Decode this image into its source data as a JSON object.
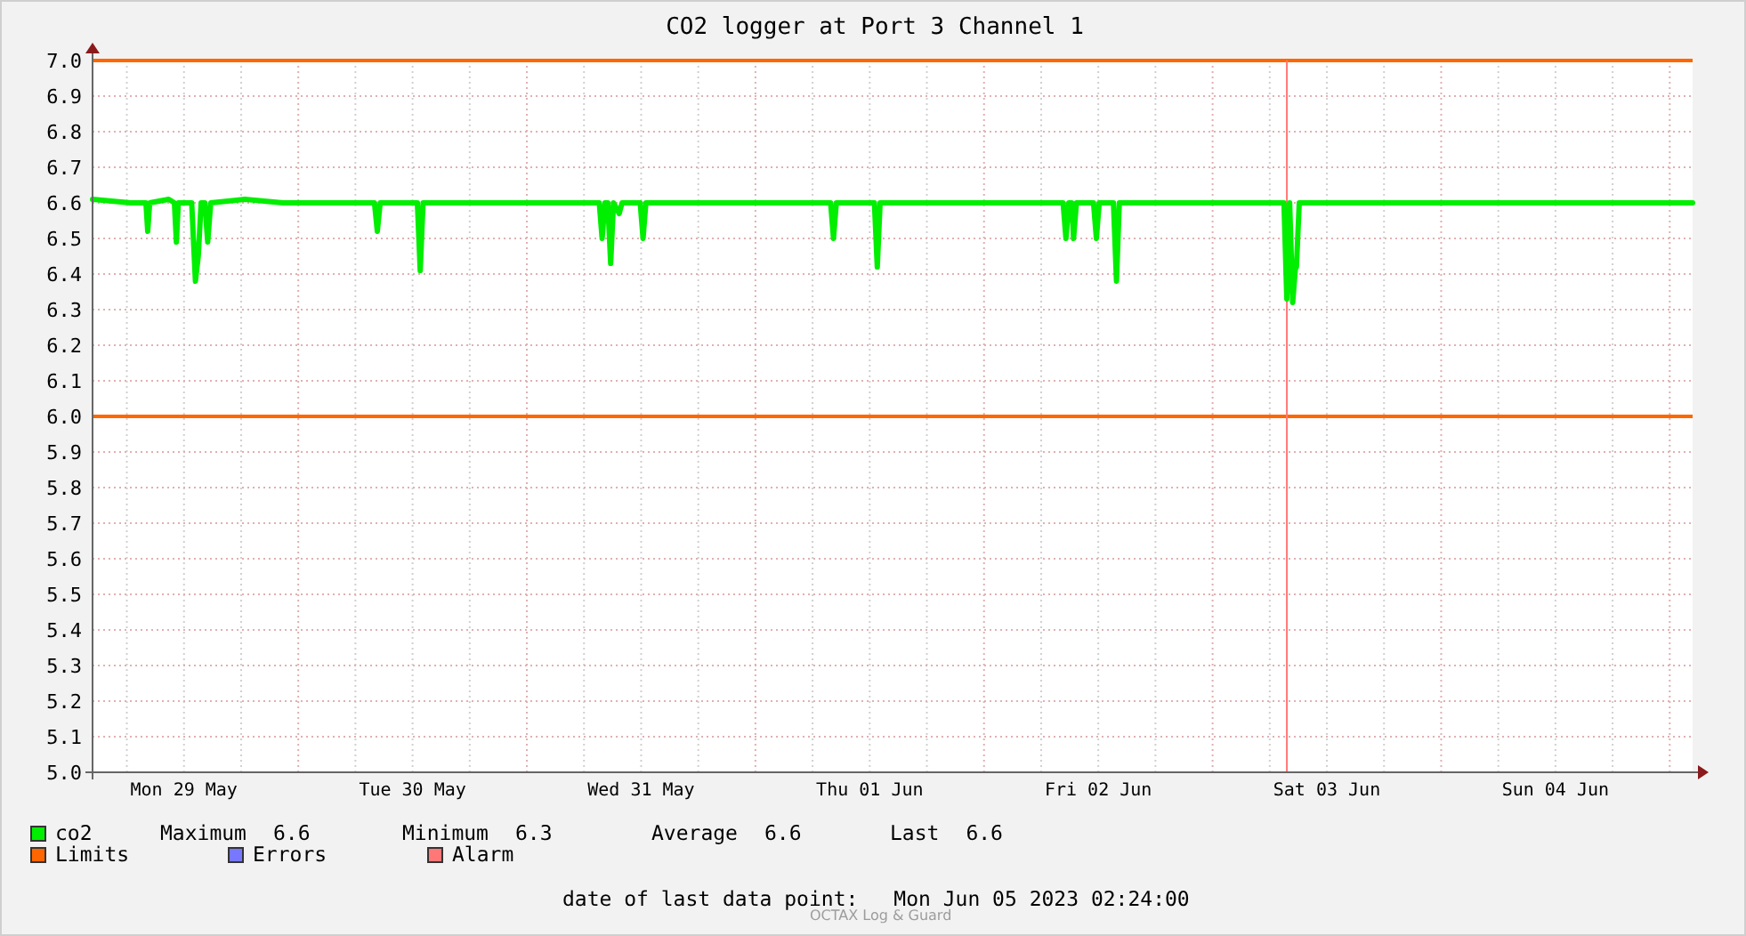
{
  "chart": {
    "chart_data": {
      "type": "line",
      "title": "CO2 logger at Port 3 Channel 1",
      "x": [
        "2023-05-29T02:24",
        "2023-05-29T06:24",
        "2023-05-29T08:00",
        "2023-05-29T08:12",
        "2023-05-29T08:24",
        "2023-05-29T10:24",
        "2023-05-29T11:00",
        "2023-05-29T11:12",
        "2023-05-29T11:24",
        "2023-05-29T12:48",
        "2023-05-29T13:12",
        "2023-05-29T13:30",
        "2023-05-29T13:48",
        "2023-05-29T14:12",
        "2023-05-29T14:30",
        "2023-05-29T14:48",
        "2023-05-29T18:24",
        "2023-05-29T22:24",
        "2023-05-30T02:24",
        "2023-05-30T08:00",
        "2023-05-30T08:18",
        "2023-05-30T08:36",
        "2023-05-30T12:30",
        "2023-05-30T12:48",
        "2023-05-30T13:06",
        "2023-05-30T18:24",
        "2023-05-31T02:24",
        "2023-05-31T07:36",
        "2023-05-31T07:54",
        "2023-05-31T08:12",
        "2023-05-31T08:30",
        "2023-05-31T08:48",
        "2023-05-31T09:06",
        "2023-05-31T09:42",
        "2023-05-31T10:00",
        "2023-05-31T11:54",
        "2023-05-31T12:12",
        "2023-05-31T12:30",
        "2023-05-31T18:24",
        "2023-06-01T02:24",
        "2023-06-01T07:54",
        "2023-06-01T08:12",
        "2023-06-01T08:30",
        "2023-06-01T12:30",
        "2023-06-01T12:48",
        "2023-06-01T13:06",
        "2023-06-01T18:24",
        "2023-06-02T02:24",
        "2023-06-02T08:18",
        "2023-06-02T08:36",
        "2023-06-02T08:54",
        "2023-06-02T09:12",
        "2023-06-02T09:24",
        "2023-06-02T09:42",
        "2023-06-02T11:30",
        "2023-06-02T11:48",
        "2023-06-02T12:06",
        "2023-06-02T13:36",
        "2023-06-02T13:54",
        "2023-06-02T14:12",
        "2023-06-02T18:24",
        "2023-06-03T02:24",
        "2023-06-03T07:30",
        "2023-06-03T07:48",
        "2023-06-03T08:06",
        "2023-06-03T08:24",
        "2023-06-03T08:42",
        "2023-06-03T08:48",
        "2023-06-03T09:06",
        "2023-06-03T14:24",
        "2023-06-03T22:24",
        "2023-06-04T06:24",
        "2023-06-04T14:24",
        "2023-06-04T22:24",
        "2023-06-05T02:24"
      ],
      "series": [
        {
          "name": "co2",
          "color": "#00ee00",
          "values": [
            6.61,
            6.6,
            6.6,
            6.52,
            6.6,
            6.61,
            6.6,
            6.49,
            6.6,
            6.6,
            6.38,
            6.45,
            6.6,
            6.6,
            6.49,
            6.6,
            6.61,
            6.6,
            6.6,
            6.6,
            6.52,
            6.6,
            6.6,
            6.41,
            6.6,
            6.6,
            6.6,
            6.6,
            6.5,
            6.6,
            6.6,
            6.43,
            6.6,
            6.57,
            6.6,
            6.6,
            6.5,
            6.6,
            6.6,
            6.6,
            6.6,
            6.5,
            6.6,
            6.6,
            6.42,
            6.6,
            6.6,
            6.6,
            6.6,
            6.5,
            6.6,
            6.6,
            6.5,
            6.6,
            6.6,
            6.5,
            6.6,
            6.6,
            6.38,
            6.6,
            6.6,
            6.6,
            6.6,
            6.33,
            6.6,
            6.32,
            6.42,
            6.42,
            6.6,
            6.6,
            6.6,
            6.6,
            6.6,
            6.6,
            6.6
          ]
        }
      ],
      "xlim": [
        "2023-05-29T02:24",
        "2023-06-05T02:24"
      ],
      "ylim": [
        5.0,
        7.0
      ],
      "grid": true,
      "xticks": [
        {
          "value": "2023-05-29T12:00",
          "label": "Mon 29 May"
        },
        {
          "value": "2023-05-30T12:00",
          "label": "Tue 30 May"
        },
        {
          "value": "2023-05-31T12:00",
          "label": "Wed 31 May"
        },
        {
          "value": "2023-06-01T12:00",
          "label": "Thu 01 Jun"
        },
        {
          "value": "2023-06-02T12:00",
          "label": "Fri 02 Jun"
        },
        {
          "value": "2023-06-03T12:00",
          "label": "Sat 03 Jun"
        },
        {
          "value": "2023-06-04T12:00",
          "label": "Sun 04 Jun"
        }
      ],
      "yticks": [
        {
          "value": 5.0,
          "label": "5.0"
        },
        {
          "value": 5.1,
          "label": "5.1"
        },
        {
          "value": 5.2,
          "label": "5.2"
        },
        {
          "value": 5.3,
          "label": "5.3"
        },
        {
          "value": 5.4,
          "label": "5.4"
        },
        {
          "value": 5.5,
          "label": "5.5"
        },
        {
          "value": 5.6,
          "label": "5.6"
        },
        {
          "value": 5.7,
          "label": "5.7"
        },
        {
          "value": 5.8,
          "label": "5.8"
        },
        {
          "value": 5.9,
          "label": "5.9"
        },
        {
          "value": 6.0,
          "label": "6.0"
        },
        {
          "value": 6.1,
          "label": "6.1"
        },
        {
          "value": 6.2,
          "label": "6.2"
        },
        {
          "value": 6.3,
          "label": "6.3"
        },
        {
          "value": 6.4,
          "label": "6.4"
        },
        {
          "value": 6.5,
          "label": "6.5"
        },
        {
          "value": 6.6,
          "label": "6.6"
        },
        {
          "value": 6.7,
          "label": "6.7"
        },
        {
          "value": 6.8,
          "label": "6.8"
        },
        {
          "value": 6.9,
          "label": "6.9"
        },
        {
          "value": 7.0,
          "label": "7.0"
        }
      ],
      "ref_lines": [
        {
          "axis": "y",
          "value": 7.0,
          "color": "#ff6600"
        },
        {
          "axis": "y",
          "value": 6.0,
          "color": "#ff6600"
        },
        {
          "axis": "x",
          "value": "2023-06-03T07:48",
          "color": "#ff7777"
        }
      ]
    }
  },
  "legend": {
    "series": {
      "stats": [
        {
          "label": "Maximum",
          "value": "6.6"
        },
        {
          "label": "Minimum",
          "value": "6.3"
        },
        {
          "label": "Average",
          "value": "6.6"
        },
        {
          "label": "Last",
          "value": "6.6"
        }
      ]
    },
    "items": [
      {
        "label": "Limits",
        "color": "#ff6600"
      },
      {
        "label": "Errors",
        "color": "#7777ff"
      },
      {
        "label": "Alarm",
        "color": "#ff7777"
      }
    ]
  },
  "footer": {
    "label": "date of last data point:",
    "value": "Mon Jun 05 2023 02:24:00"
  },
  "credit": "OCTAX Log & Guard"
}
